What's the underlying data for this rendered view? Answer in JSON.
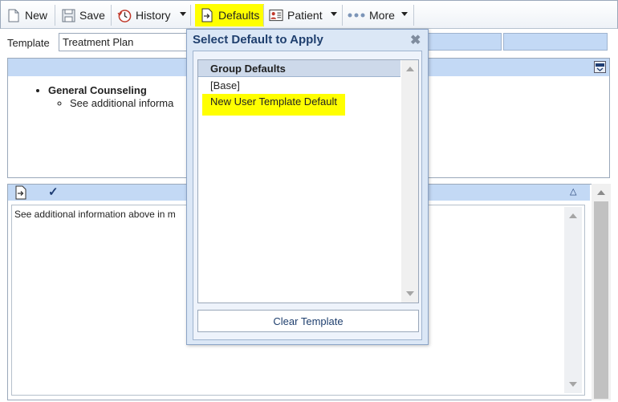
{
  "toolbar": {
    "new_label": "New",
    "save_label": "Save",
    "history_label": "History",
    "defaults_label": "Defaults",
    "patient_label": "Patient",
    "more_label": "More",
    "defaults_highlight": "#ffff00"
  },
  "template": {
    "label": "Template",
    "value": "Treatment Plan"
  },
  "upper_panel": {
    "item_heading": "General Counseling",
    "item_sub": "See additional informa"
  },
  "lower_panel": {
    "text": "See additional information above in m"
  },
  "modal": {
    "title": "Select Default to Apply",
    "close_glyph": "✖",
    "list_header": "Group Defaults",
    "items": [
      "[Base]",
      "New User Template Default"
    ],
    "clear_button": "Clear Template",
    "highlight_color": "#ffff00"
  },
  "colors": {
    "accent_blue": "#c3d9f5",
    "modal_title": "#1f3f6e"
  }
}
